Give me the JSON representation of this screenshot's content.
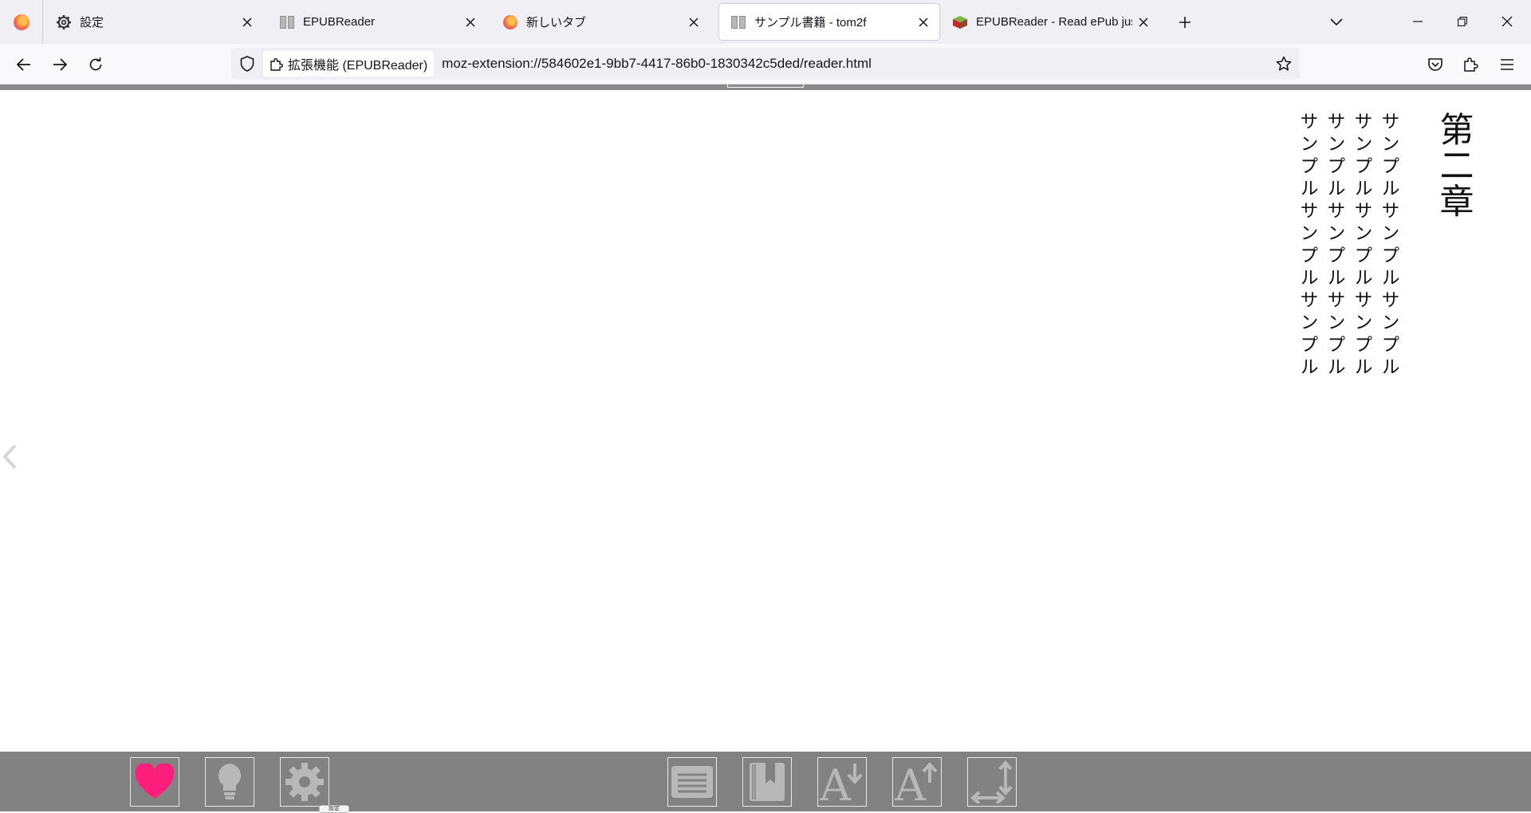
{
  "tabs": [
    {
      "label": "設定",
      "icon": "gear-icon",
      "active": false
    },
    {
      "label": "EPUBReader",
      "icon": "book-icon",
      "active": false
    },
    {
      "label": "新しいタブ",
      "icon": "firefox-icon",
      "active": false
    },
    {
      "label": "サンプル書籍 - tom2f",
      "icon": "book-icon",
      "active": true
    },
    {
      "label": "EPUBReader - Read ePub just in",
      "icon": "epubreader-logo-icon",
      "active": false
    }
  ],
  "navbar": {
    "extension_label": "拡張機能 (EPUBReader)",
    "url": "moz-extension://584602e1-9bb7-4417-86b0-1830342c5ded/reader.html"
  },
  "book": {
    "chapter_title": "第二章",
    "lines": [
      "サンプルサンプルサンプル",
      "サンプルサンプルサンプル",
      "サンプルサンプルサンプル",
      "サンプルサンプルサンプル"
    ]
  },
  "toolbar": {
    "buttons": [
      {
        "name": "donate-heart-button",
        "icon": "heart-icon",
        "color": "#ff1f7a"
      },
      {
        "name": "tips-button",
        "icon": "lightbulb-icon",
        "color": "#b8b8b8"
      },
      {
        "name": "settings-button",
        "icon": "gear-icon",
        "color": "#b8b8b8"
      },
      {
        "name": "toc-button",
        "icon": "list-icon",
        "color": "#b8b8b8"
      },
      {
        "name": "bookmark-button",
        "icon": "bookmark-icon",
        "color": "#b8b8b8"
      },
      {
        "name": "font-decrease-button",
        "icon": "font-decrease-icon",
        "color": "#b8b8b8"
      },
      {
        "name": "font-increase-button",
        "icon": "font-increase-icon",
        "color": "#b8b8b8"
      },
      {
        "name": "layout-button",
        "icon": "resize-arrows-icon",
        "color": "#b8b8b8"
      }
    ],
    "tooltip": "設定"
  }
}
